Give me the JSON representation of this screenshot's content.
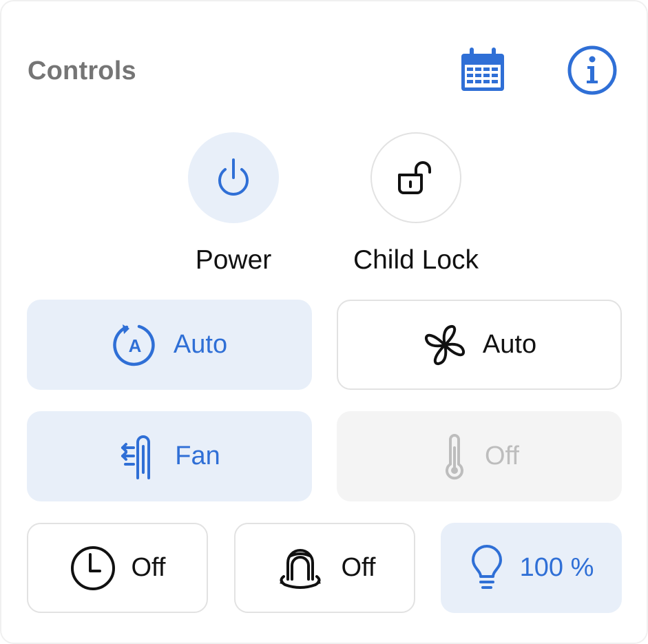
{
  "header": {
    "title": "Controls",
    "icons": [
      "calendar-icon",
      "info-icon"
    ],
    "accent_color": "#2f6fd6"
  },
  "power": {
    "label": "Power",
    "state": "on",
    "icon": "power-icon"
  },
  "child_lock": {
    "label": "Child Lock",
    "state": "unlocked",
    "icon": "unlock-icon"
  },
  "tiles": {
    "mode": {
      "label": "Auto",
      "icon": "auto-mode-icon",
      "active": true
    },
    "fan_speed": {
      "label": "Auto",
      "icon": "fan-blades-icon",
      "active": false
    },
    "fan": {
      "label": "Fan",
      "icon": "air-flow-icon",
      "active": true
    },
    "temperature": {
      "label": "Off",
      "icon": "thermometer-icon",
      "disabled": true
    },
    "timer": {
      "label": "Off",
      "icon": "clock-icon",
      "active": false
    },
    "swing": {
      "label": "Off",
      "icon": "swing-icon",
      "active": false
    },
    "light": {
      "label": "100 %",
      "icon": "lightbulb-icon",
      "active": true
    }
  },
  "colors": {
    "active_bg": "#e8eff9",
    "disabled_bg": "#f4f4f4",
    "disabled_text": "#bdbdbd",
    "title_text": "#757575"
  }
}
